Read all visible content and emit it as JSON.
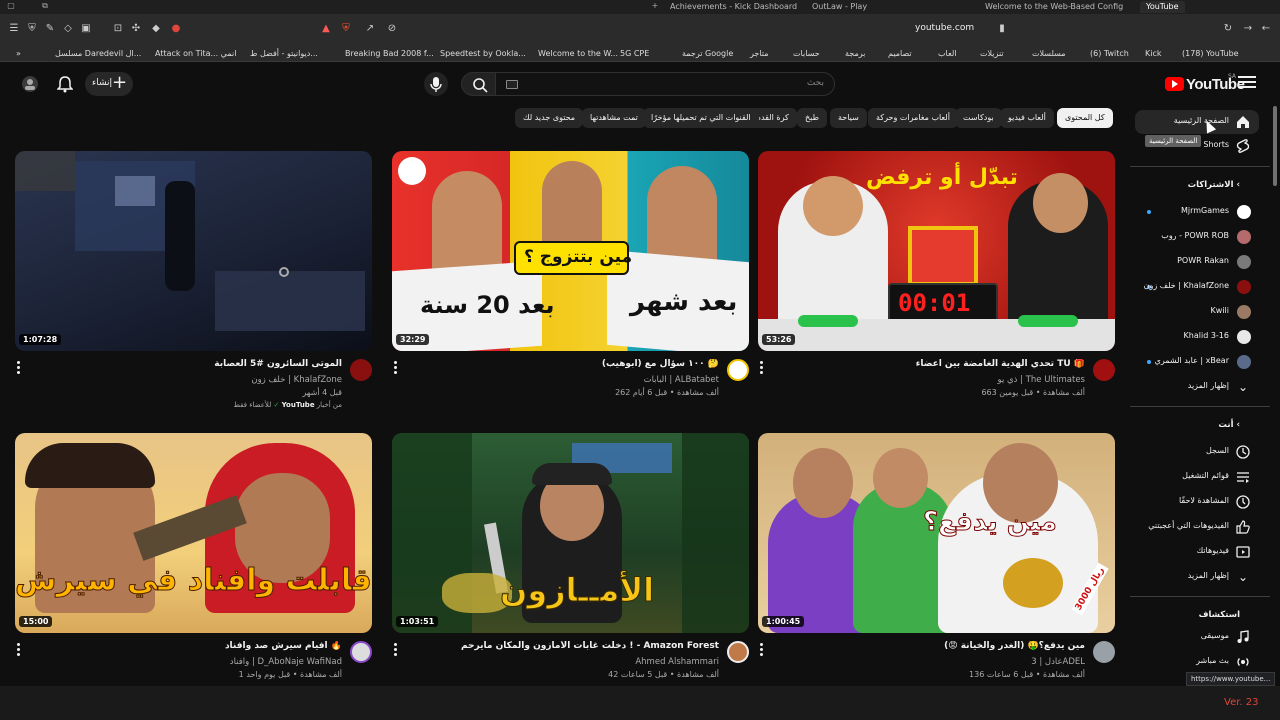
{
  "browser": {
    "tabs": [
      {
        "label": "Achievements - Kick Dashboard"
      },
      {
        "label": "OutLaw - Play"
      },
      {
        "label": "Welcome to the Web-Based Config"
      },
      {
        "label": "YouTube"
      }
    ],
    "url": "youtube.com",
    "bookmarks": [
      "مسلسل Daredevil ال...",
      "Attack on Tita... انمي",
      "ديوانيتو - أفضل ط...",
      "Breaking Bad 2008 f...",
      "Speedtest by Ookla...",
      "Welcome to the W...",
      "5G CPE",
      "ترجمة Google",
      "متاجر",
      "حسابات",
      "برمجة",
      "تصاميم",
      "العاب",
      "تنزيلات",
      "مسلسلات",
      "(6) Twitch",
      "Kick",
      "(178) YouTube"
    ]
  },
  "header": {
    "logo_text": "YouTube",
    "country_code": "SA",
    "search_placeholder": "بحث",
    "create_label": "إنشاء"
  },
  "chips": [
    "كل المحتوى",
    "ألعاب فيديو",
    "بودكاست",
    "ألعاب مغامرات وحركة",
    "سياحة",
    "طبخ",
    "كرة القدم",
    "القنوات التي تم تحميلها مؤخرًا",
    "تمت مشاهدتها",
    "محتوى جديد لك"
  ],
  "videos": [
    {
      "title": "الموتى السائرون #5 العصابة",
      "channel": "خلف زون | KhalafZone",
      "stats": "قبل 4 أشهر",
      "duration": "1:07:28",
      "note_from": "من أخبار",
      "note_yt": "YouTube",
      "note_members": "للأعضاء فقط"
    },
    {
      "title": "١٠٠ سؤال مع (ابوهيب) 🤔",
      "channel": "البابات | ALBatabet",
      "stats": "262 ألف مشاهدة • قبل 6 أيام",
      "duration": "32:29"
    },
    {
      "title": "تحدي الهدية الغامضة بين أعضاء TU 🎁",
      "channel": "ذي يو | The Ultimates",
      "stats": "663 ألف مشاهدة • قبل يومين",
      "duration": "53:26"
    },
    {
      "title": "افيام سيرش صد وافناد 🔥",
      "channel": "وافناد | D_AboNaje WafiNad",
      "stats": "1 ألف مشاهدة • قبل يوم واحد",
      "duration": "15:00"
    },
    {
      "title": "دخلت غابات الأمازون والمكان مايرحم ! - Amazon Forest",
      "channel": "Ahmed Alshammari",
      "stats": "42 ألف مشاهدة • قبل 5 ساعات",
      "duration": "1:03:51"
    },
    {
      "title": "مين يدفع؟🤑 (الغدر والخيانة 😡)",
      "channel": "عادل | 3ADEL",
      "stats": "136 ألف مشاهدة • قبل 6 ساعات",
      "duration": "1:00:45"
    }
  ],
  "thumb_text": {
    "v2_bubble": "مين بتتزوج ؟",
    "v2_left": "بعد 20 سنة",
    "v2_right": "بعد شهر",
    "v3_top": "تبدّل أو ترفض",
    "v3_timer": "00:01",
    "v4_text": "قابلت وافناد في سيرش",
    "v5_text": "الأمــازون",
    "v6_text": "مين يدفع؟",
    "v6_price": "3000 ريال"
  },
  "sidebar": {
    "home": "الصفحة الرئيسية",
    "shorts": "Shorts",
    "tooltip": "الصفحة الرئيسية",
    "subscriptions_header": "الاشتراكات",
    "subscriptions": [
      "MjrmGames",
      "روب - POWR ROB",
      "POWR Rakan",
      "خلف زون | KhalafZone",
      "Kwili",
      "Khalid 3-16",
      "عابد الشمري | xBear"
    ],
    "show_more_1": "إظهار المزيد",
    "you_header": "أنت",
    "you_items": [
      "السجل",
      "قوائم التشغيل",
      "المشاهدة لاحقًا",
      "الفيديوهات التي أعجبتني",
      "فيديوهاتك",
      "إظهار المزيد"
    ],
    "explore_header": "استكشاف",
    "explore_items": [
      "موسيقى",
      "بث مباشر"
    ]
  },
  "status_url": "https://www.youtube...",
  "version": "Ver. 23"
}
